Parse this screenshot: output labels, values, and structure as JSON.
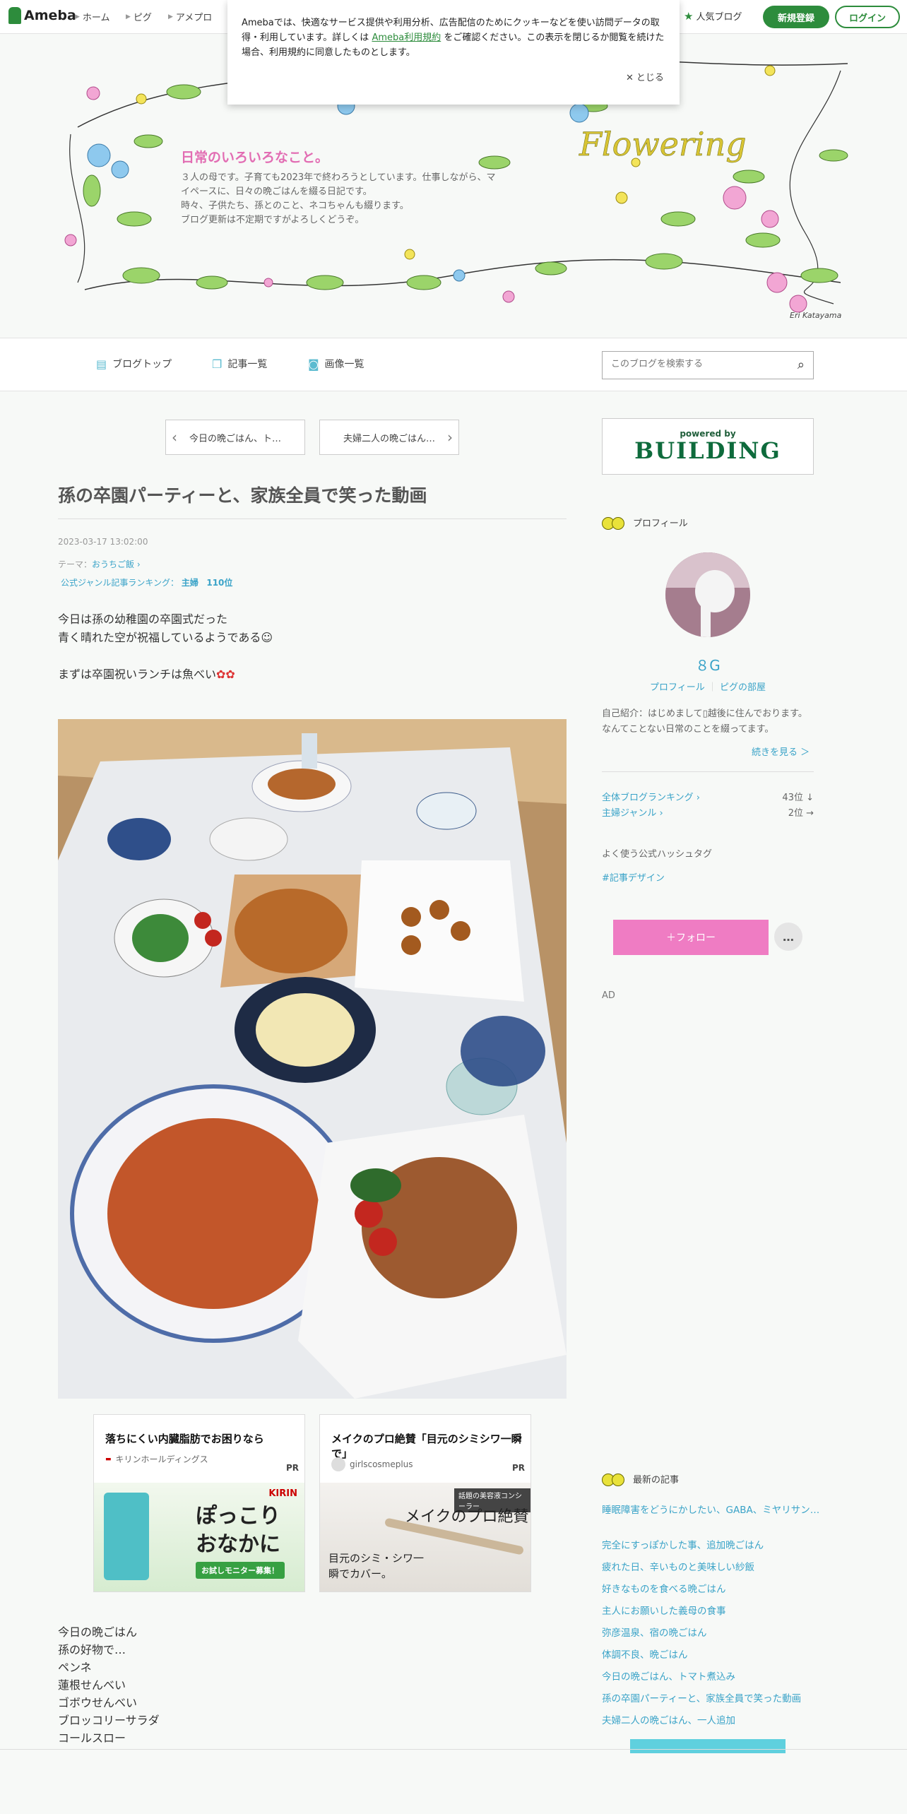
{
  "topbar": {
    "logo": "Ameba",
    "nav": [
      "ホーム",
      "ピグ",
      "アメプロ"
    ],
    "popular": "人気ブログ",
    "signup": "新規登録",
    "login": "ログイン"
  },
  "cookie": {
    "text_before": "Amebaでは、快適なサービス提供や利用分析、広告配信のためにクッキーなどを使い訪問データの取得・利用しています。詳しくは",
    "link": "Ameba利用規約",
    "text_after": "をご確認ください。この表示を閉じるか閲覧を続けた場合、利用規約に同意したものとします。",
    "close": "とじる"
  },
  "header": {
    "blog_title": "日常のいろいろなこと。",
    "description": [
      "３人の母です。子育ても2023年で終わろうとしています。仕事しながら、マ",
      "イペースに、日々の晩ごはんを綴る日記です。",
      "時々、子供たち、孫とのこと、ネコちゃんも綴ります。",
      "ブログ更新は不定期ですがよろしくどうぞ。"
    ],
    "signature": "Eri Katayama"
  },
  "nav": {
    "blog_top": "ブログトップ",
    "entries": "記事一覧",
    "images": "画像一覧",
    "search_placeholder": "このブログを検索する"
  },
  "pager": {
    "prev": "今日の晩ごはん、ト…",
    "next": "夫婦二人の晩ごはん…"
  },
  "article": {
    "title": "孫の卒園パーティーと、家族全員で笑った動画",
    "date": "2023-03-17 13:02:00",
    "theme_label": "テーマ：",
    "theme": "おうちご飯",
    "ranking_label": "公式ジャンル記事ランキング：",
    "ranking_genre": "主婦",
    "ranking_value": "110位",
    "para1_line1": "今日は孫の幼稚園の卒園式だった",
    "para1_line2": "青く晴れた空が祝福しているようである",
    "para2": "まずは卒園祝いランチは魚べい",
    "list": [
      "今日の晩ごはん",
      "孫の好物で…",
      "ペンネ",
      "蓮根せんべい",
      "ゴボウせんべい",
      "ブロッコリーサラダ",
      "コールスロー"
    ]
  },
  "ads": [
    {
      "title": "落ちにくい内臓脂肪でお困りなら",
      "sponsor": "キリンホールディングス",
      "pr": "PR",
      "img_text1": "ぽっこり",
      "img_text2": "おなかに",
      "img_badge": "お試しモニター募集！",
      "img_brand": "KIRIN"
    },
    {
      "title": "メイクのプロ絶賛「目元のシミシワ一瞬で」",
      "sponsor": "girlscosmeplus",
      "pr": "PR",
      "img_text1": "メイクのプロ絶賛",
      "img_text2": "目元のシミ・シワ一瞬でカバー。",
      "img_badge": "話題の美容液コンシーラー"
    }
  ],
  "sidebar": {
    "powered_by": "powered by",
    "building": "BUILDING",
    "profile_heading": "プロフィール",
    "nickname": "８G",
    "profile_link": "プロフィール",
    "pig_link": "ピグの部屋",
    "intro": "自己紹介：はじめまして▯越後に住んでおります。 なんてことない日常のことを綴ってます。",
    "more": "続きを見る ＞",
    "overall_rank_label": "全体ブログランキング",
    "overall_rank_value": "43位 ↓",
    "genre_rank_label": "主婦ジャンル",
    "genre_rank_value": "2位 →",
    "hashtag_heading": "よく使う公式ハッシュタグ",
    "hashtag": "#記事デザイン",
    "follow": "＋フォロー",
    "more_dots": "…",
    "ad_label": "AD",
    "latest_heading": "最新の記事",
    "latest": [
      "睡眠障害をどうにかしたい、GABA、ミヤリサン…",
      "完全にすっぽかした事、追加晩ごはん",
      "疲れた日、辛いものと美味しい紗飯",
      "好きなものを食べる晩ごはん",
      "主人にお願いした義母の食事",
      "弥彦温泉、宿の晩ごはん",
      "体調不良、晩ごはん",
      "今日の晩ごはん、トマト煮込み",
      "孫の卒園パーティーと、家族全員で笑った動画",
      "夫婦二人の晩ごはん、一人追加"
    ]
  }
}
